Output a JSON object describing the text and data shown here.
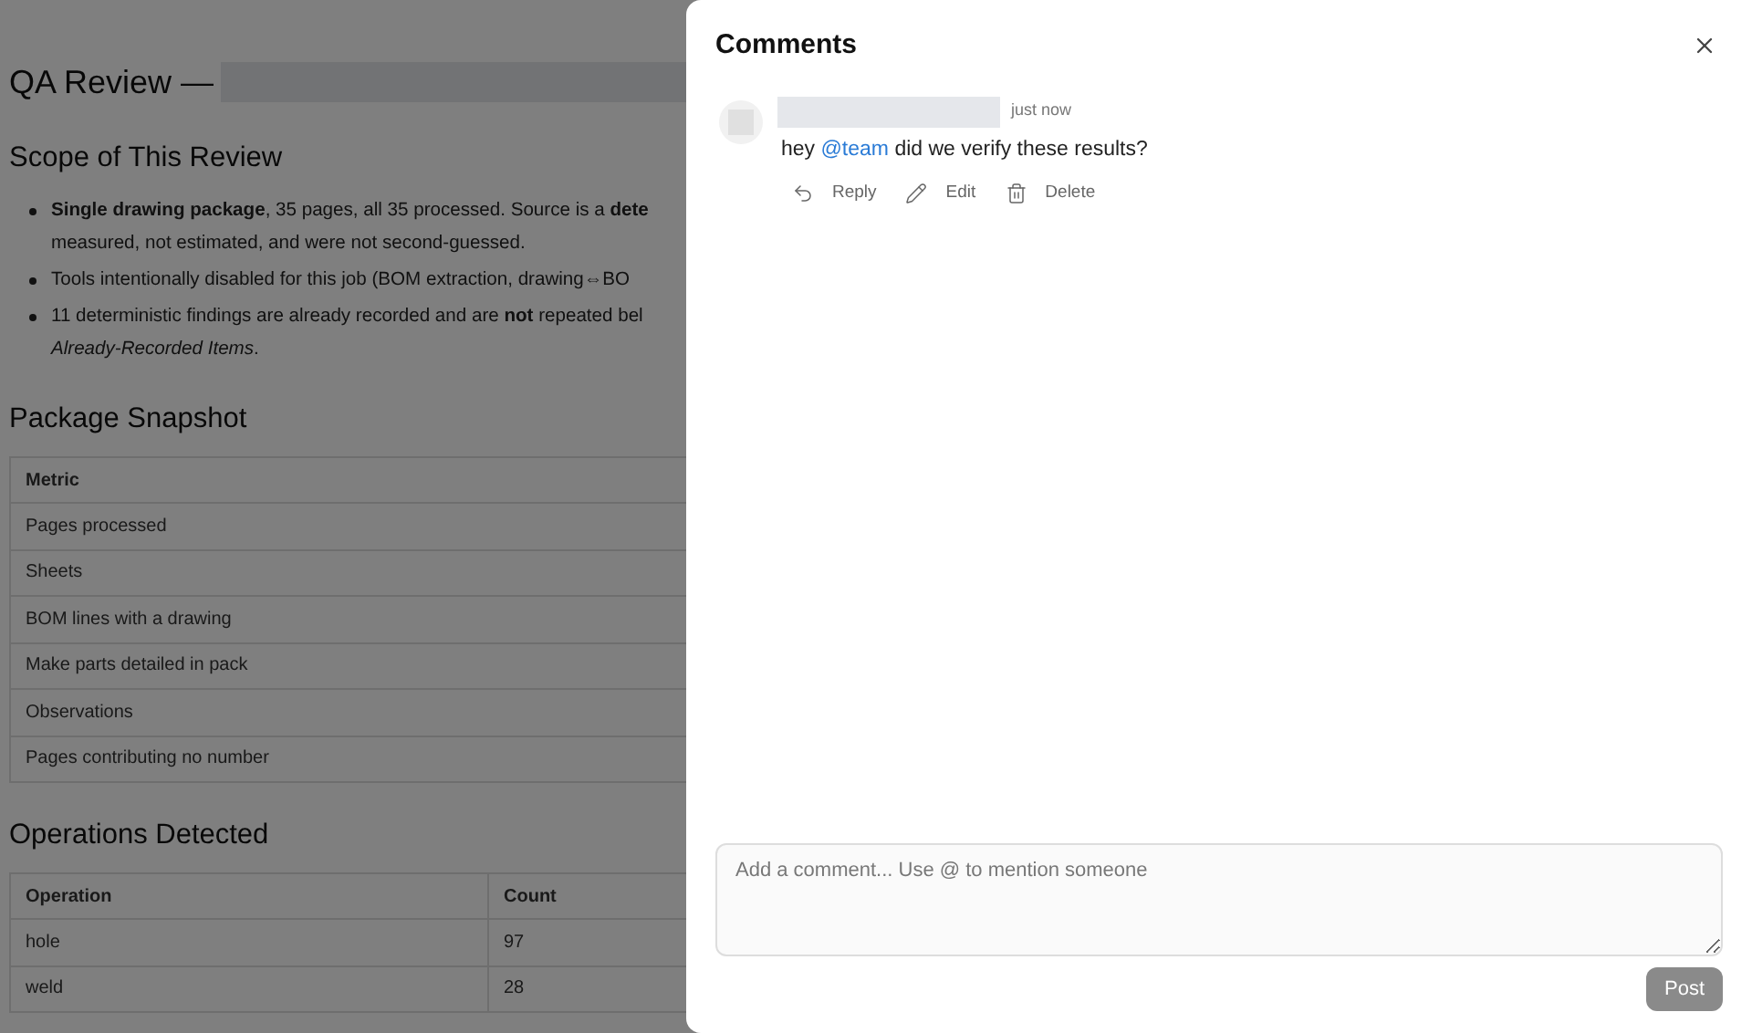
{
  "page": {
    "title": "QA Review —",
    "sections": [
      {
        "kind": "bullets",
        "heading": "Scope of This Review",
        "bullets": [
          {
            "lines": [
              "**Single drawing package**, 35 pages, all 35 processed. Source is a **dete**",
              "measured, not estimated, and were not second-guessed."
            ]
          },
          {
            "lines": [
              "Tools intentionally disabled for this job (BOM extraction, drawing⇔BO"
            ]
          },
          {
            "lines": [
              "11 deterministic findings are already recorded and are **not** repeated bel",
              "*Already-Recorded Items*."
            ]
          }
        ]
      },
      {
        "kind": "table",
        "heading": "Package Snapshot",
        "columns": [
          "Metric"
        ],
        "rows": [
          [
            "Pages processed"
          ],
          [
            "Sheets"
          ],
          [
            "BOM lines with a drawing"
          ],
          [
            "Make parts detailed in pack"
          ],
          [
            "Observations"
          ],
          [
            "Pages contributing no number"
          ]
        ]
      },
      {
        "kind": "table",
        "heading": "Operations Detected",
        "columns": [
          "Operation",
          "Count"
        ],
        "rows": [
          [
            "hole",
            "97"
          ],
          [
            "weld",
            "28"
          ]
        ]
      }
    ]
  },
  "comments_panel": {
    "title": "Comments",
    "comments": [
      {
        "time": "just now",
        "text": "hey **@team** did we verify these results?",
        "actions": [
          {
            "kind": "reply",
            "label": "Reply"
          },
          {
            "kind": "edit",
            "label": "Edit"
          },
          {
            "kind": "delete",
            "label": "Delete"
          }
        ]
      }
    ],
    "input": {
      "placeholder": "Add a comment... Use @ to mention someone"
    },
    "post_button": {
      "label": "Post",
      "disabled": true
    }
  }
}
